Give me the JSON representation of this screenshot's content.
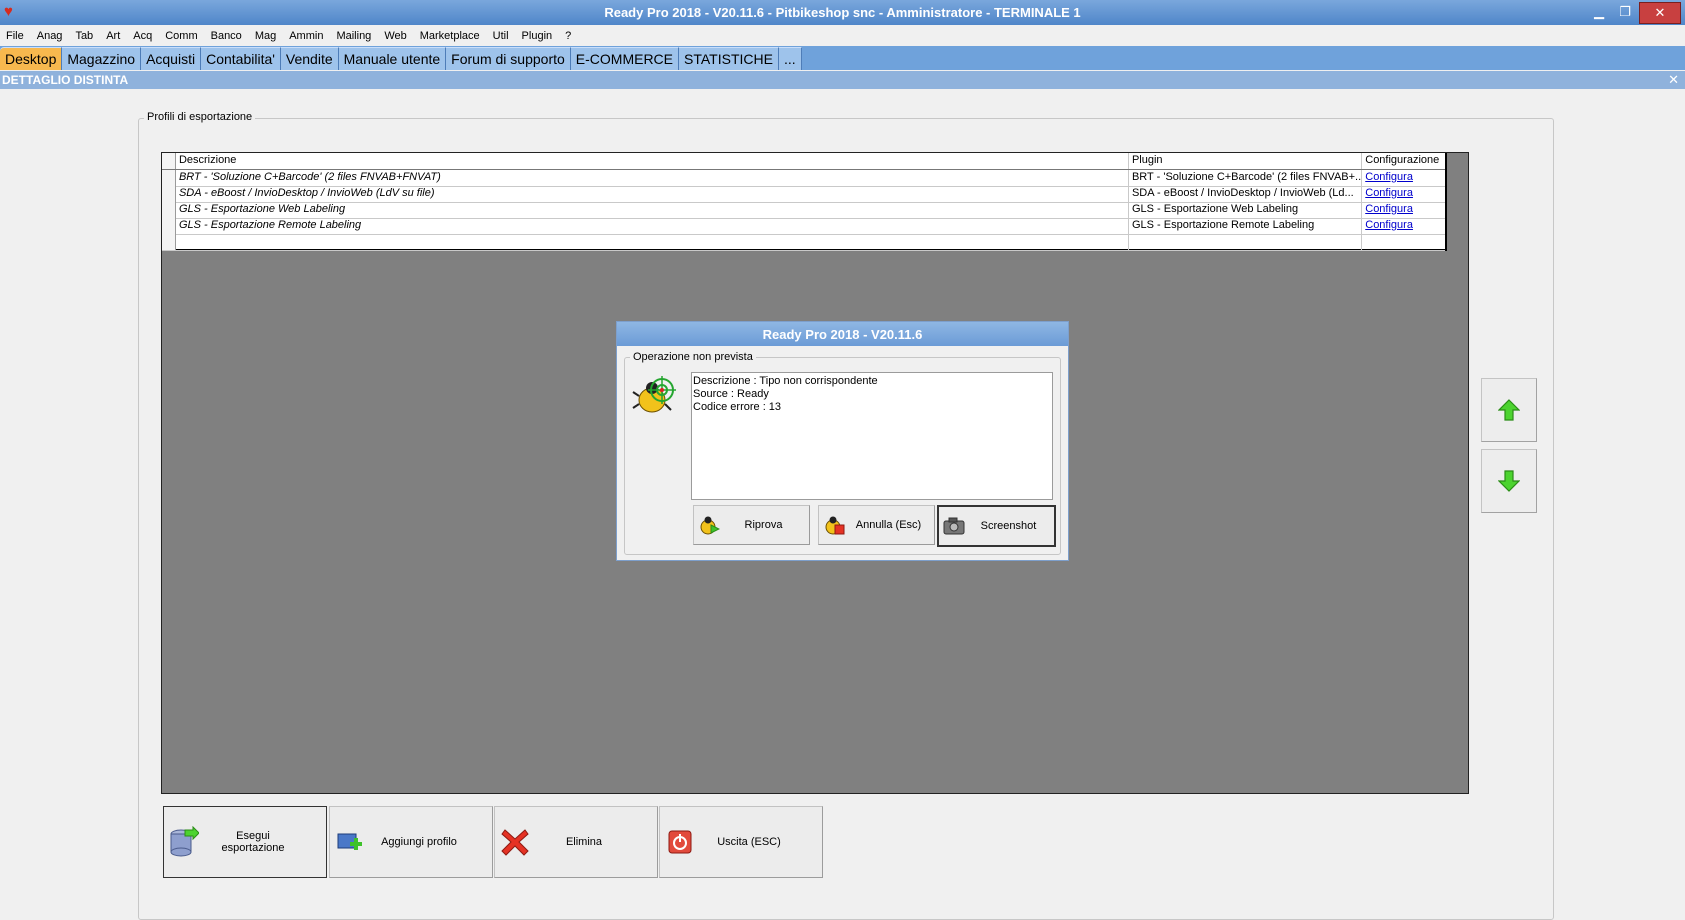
{
  "window": {
    "title": "Ready Pro 2018 - V20.11.6 - Pitbikeshop snc - Amministratore - TERMINALE 1",
    "minimize": "▁",
    "restore": "❐",
    "close": "✕"
  },
  "menu": [
    "File",
    "Anag",
    "Tab",
    "Art",
    "Acq",
    "Comm",
    "Banco",
    "Mag",
    "Ammin",
    "Mailing",
    "Web",
    "Marketplace",
    "Util",
    "Plugin",
    "?"
  ],
  "tabs": [
    "Desktop",
    "Magazzino",
    "Acquisti",
    "Contabilita'",
    "Vendite",
    "Manuale utente",
    "Forum di supporto",
    "E-COMMERCE",
    "STATISTICHE",
    "..."
  ],
  "subheader": {
    "title": "DETTAGLIO DISTINTA",
    "close": "✕"
  },
  "group": {
    "title": "Profili di esportazione"
  },
  "table": {
    "headers": [
      "Descrizione",
      "Plugin",
      "Configurazione"
    ],
    "rows": [
      {
        "descrizione": "BRT - 'Soluzione C+Barcode' (2 files FNVAB+FNVAT)",
        "plugin": "BRT - 'Soluzione C+Barcode' (2 files FNVAB+...",
        "config": "Configura"
      },
      {
        "descrizione": "SDA - eBoost / InvioDesktop / InvioWeb (LdV su file)",
        "plugin": "SDA - eBoost / InvioDesktop / InvioWeb (Ld...",
        "config": "Configura"
      },
      {
        "descrizione": "GLS - Esportazione Web Labeling",
        "plugin": "GLS - Esportazione Web Labeling",
        "config": "Configura"
      },
      {
        "descrizione": "GLS - Esportazione Remote Labeling",
        "plugin": "GLS - Esportazione Remote Labeling",
        "config": "Configura"
      }
    ]
  },
  "dialog": {
    "title": "Ready Pro 2018 - V20.11.6",
    "group_title": "Operazione non prevista",
    "lines": [
      "Descrizione : Tipo non corrispondente",
      "Source : Ready",
      "Codice errore : 13"
    ],
    "buttons": {
      "retry": "Riprova",
      "cancel": "Annulla (Esc)",
      "screenshot": "Screenshot"
    }
  },
  "actions": {
    "export": "Esegui esportazione",
    "add": "Aggiungi profilo",
    "delete": "Elimina",
    "exit": "Uscita (ESC)"
  }
}
